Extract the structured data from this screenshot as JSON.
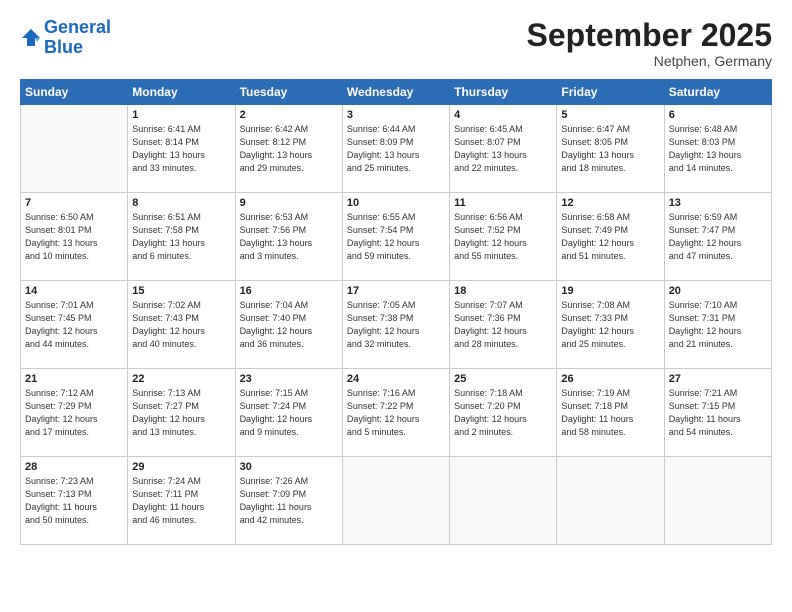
{
  "header": {
    "logo_line1": "General",
    "logo_line2": "Blue",
    "month_title": "September 2025",
    "subtitle": "Netphen, Germany"
  },
  "days_of_week": [
    "Sunday",
    "Monday",
    "Tuesday",
    "Wednesday",
    "Thursday",
    "Friday",
    "Saturday"
  ],
  "weeks": [
    [
      {
        "day": "",
        "info": ""
      },
      {
        "day": "1",
        "info": "Sunrise: 6:41 AM\nSunset: 8:14 PM\nDaylight: 13 hours\nand 33 minutes."
      },
      {
        "day": "2",
        "info": "Sunrise: 6:42 AM\nSunset: 8:12 PM\nDaylight: 13 hours\nand 29 minutes."
      },
      {
        "day": "3",
        "info": "Sunrise: 6:44 AM\nSunset: 8:09 PM\nDaylight: 13 hours\nand 25 minutes."
      },
      {
        "day": "4",
        "info": "Sunrise: 6:45 AM\nSunset: 8:07 PM\nDaylight: 13 hours\nand 22 minutes."
      },
      {
        "day": "5",
        "info": "Sunrise: 6:47 AM\nSunset: 8:05 PM\nDaylight: 13 hours\nand 18 minutes."
      },
      {
        "day": "6",
        "info": "Sunrise: 6:48 AM\nSunset: 8:03 PM\nDaylight: 13 hours\nand 14 minutes."
      }
    ],
    [
      {
        "day": "7",
        "info": "Sunrise: 6:50 AM\nSunset: 8:01 PM\nDaylight: 13 hours\nand 10 minutes."
      },
      {
        "day": "8",
        "info": "Sunrise: 6:51 AM\nSunset: 7:58 PM\nDaylight: 13 hours\nand 6 minutes."
      },
      {
        "day": "9",
        "info": "Sunrise: 6:53 AM\nSunset: 7:56 PM\nDaylight: 13 hours\nand 3 minutes."
      },
      {
        "day": "10",
        "info": "Sunrise: 6:55 AM\nSunset: 7:54 PM\nDaylight: 12 hours\nand 59 minutes."
      },
      {
        "day": "11",
        "info": "Sunrise: 6:56 AM\nSunset: 7:52 PM\nDaylight: 12 hours\nand 55 minutes."
      },
      {
        "day": "12",
        "info": "Sunrise: 6:58 AM\nSunset: 7:49 PM\nDaylight: 12 hours\nand 51 minutes."
      },
      {
        "day": "13",
        "info": "Sunrise: 6:59 AM\nSunset: 7:47 PM\nDaylight: 12 hours\nand 47 minutes."
      }
    ],
    [
      {
        "day": "14",
        "info": "Sunrise: 7:01 AM\nSunset: 7:45 PM\nDaylight: 12 hours\nand 44 minutes."
      },
      {
        "day": "15",
        "info": "Sunrise: 7:02 AM\nSunset: 7:43 PM\nDaylight: 12 hours\nand 40 minutes."
      },
      {
        "day": "16",
        "info": "Sunrise: 7:04 AM\nSunset: 7:40 PM\nDaylight: 12 hours\nand 36 minutes."
      },
      {
        "day": "17",
        "info": "Sunrise: 7:05 AM\nSunset: 7:38 PM\nDaylight: 12 hours\nand 32 minutes."
      },
      {
        "day": "18",
        "info": "Sunrise: 7:07 AM\nSunset: 7:36 PM\nDaylight: 12 hours\nand 28 minutes."
      },
      {
        "day": "19",
        "info": "Sunrise: 7:08 AM\nSunset: 7:33 PM\nDaylight: 12 hours\nand 25 minutes."
      },
      {
        "day": "20",
        "info": "Sunrise: 7:10 AM\nSunset: 7:31 PM\nDaylight: 12 hours\nand 21 minutes."
      }
    ],
    [
      {
        "day": "21",
        "info": "Sunrise: 7:12 AM\nSunset: 7:29 PM\nDaylight: 12 hours\nand 17 minutes."
      },
      {
        "day": "22",
        "info": "Sunrise: 7:13 AM\nSunset: 7:27 PM\nDaylight: 12 hours\nand 13 minutes."
      },
      {
        "day": "23",
        "info": "Sunrise: 7:15 AM\nSunset: 7:24 PM\nDaylight: 12 hours\nand 9 minutes."
      },
      {
        "day": "24",
        "info": "Sunrise: 7:16 AM\nSunset: 7:22 PM\nDaylight: 12 hours\nand 5 minutes."
      },
      {
        "day": "25",
        "info": "Sunrise: 7:18 AM\nSunset: 7:20 PM\nDaylight: 12 hours\nand 2 minutes."
      },
      {
        "day": "26",
        "info": "Sunrise: 7:19 AM\nSunset: 7:18 PM\nDaylight: 11 hours\nand 58 minutes."
      },
      {
        "day": "27",
        "info": "Sunrise: 7:21 AM\nSunset: 7:15 PM\nDaylight: 11 hours\nand 54 minutes."
      }
    ],
    [
      {
        "day": "28",
        "info": "Sunrise: 7:23 AM\nSunset: 7:13 PM\nDaylight: 11 hours\nand 50 minutes."
      },
      {
        "day": "29",
        "info": "Sunrise: 7:24 AM\nSunset: 7:11 PM\nDaylight: 11 hours\nand 46 minutes."
      },
      {
        "day": "30",
        "info": "Sunrise: 7:26 AM\nSunset: 7:09 PM\nDaylight: 11 hours\nand 42 minutes."
      },
      {
        "day": "",
        "info": ""
      },
      {
        "day": "",
        "info": ""
      },
      {
        "day": "",
        "info": ""
      },
      {
        "day": "",
        "info": ""
      }
    ]
  ]
}
